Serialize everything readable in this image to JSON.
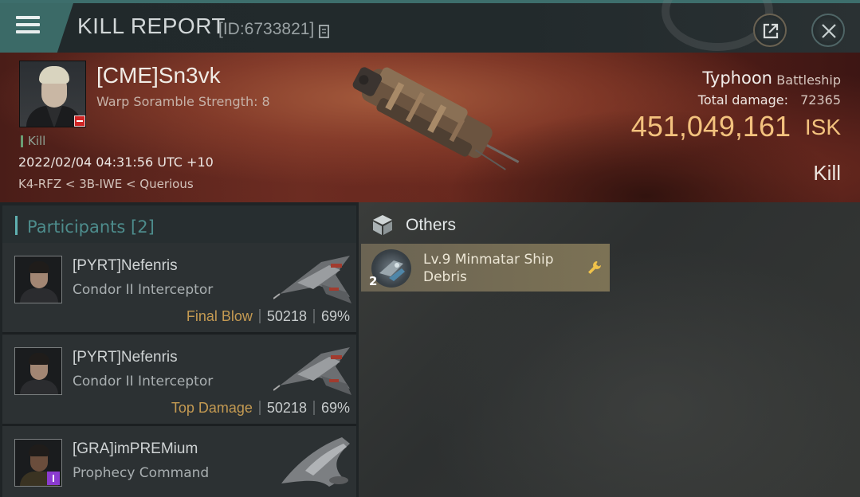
{
  "header": {
    "title": "KILL REPORT",
    "id_text": "[ID:6733821]"
  },
  "victim": {
    "name": "[CME]Sn3vk",
    "warp_scramble": "Warp Soramble Strength: 8",
    "tag": "Kill",
    "timestamp": "2022/02/04 04:31:56 UTC +10",
    "location": "K4-RFZ < 3B-IWE < Querious",
    "ship_name": "Typhoon",
    "ship_class": "Battleship",
    "total_damage_label": "Total damage:",
    "total_damage_value": "72365",
    "isk_value": "451,049,161",
    "isk_unit": "ISK",
    "result": "Kill"
  },
  "participants": {
    "title": "Participants [2]",
    "items": [
      {
        "name": "[PYRT]Nefenris",
        "ship": "Condor II Interceptor",
        "role": "Final Blow",
        "damage": "50218",
        "percent": "69%"
      },
      {
        "name": "[PYRT]Nefenris",
        "ship": "Condor II Interceptor",
        "role": "Top Damage",
        "damage": "50218",
        "percent": "69%"
      },
      {
        "name": "[GRA]imPREMium",
        "ship": "Prophecy Command",
        "role": "",
        "damage": "",
        "percent": ""
      }
    ]
  },
  "others": {
    "title": "Others",
    "items": [
      {
        "name": "Lv.9 Minmatar Ship Debris",
        "quantity": "2",
        "icon": "wrench-icon"
      }
    ]
  },
  "colors": {
    "accent_teal": "#3d6e6c",
    "isk_gold": "#f3c27e",
    "role_gold": "#c49a52",
    "item_card": "#7c7255"
  }
}
